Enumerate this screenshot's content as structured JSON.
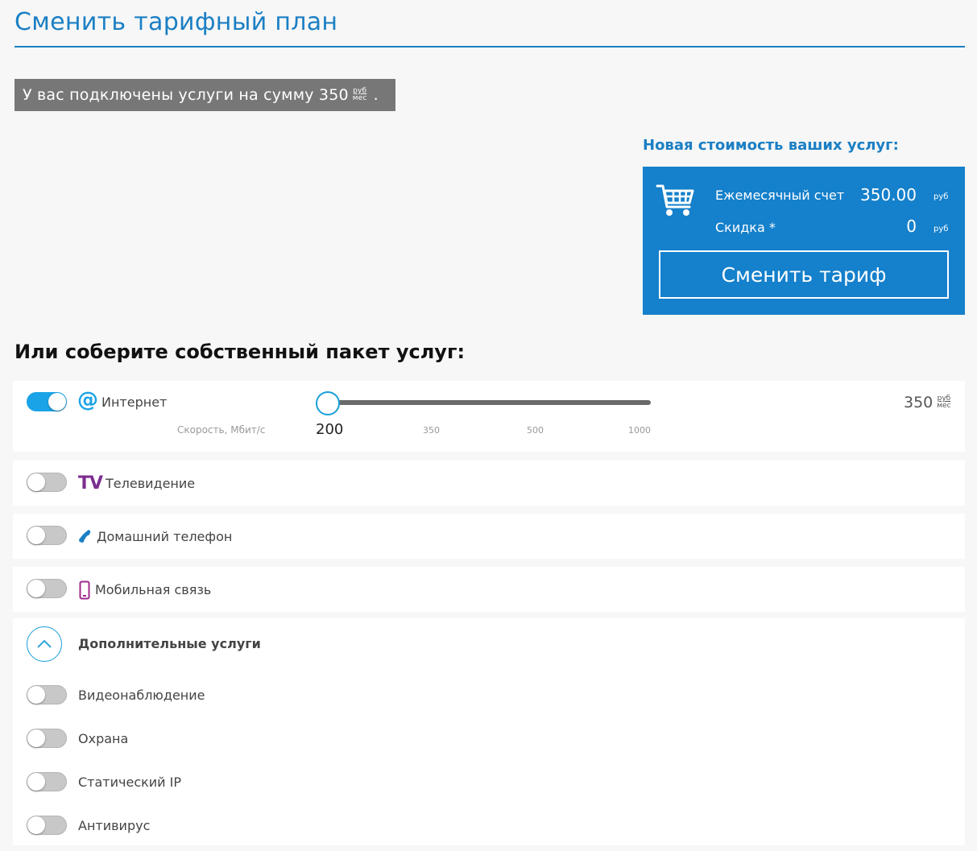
{
  "page": {
    "title": "Сменить тарифный план"
  },
  "current": {
    "text": "У вас подключены услуги на сумму 350",
    "unit_top": "руб",
    "unit_bottom": "мес",
    "suffix": "."
  },
  "new_cost": {
    "title": "Новая стоимость ваших услуг:",
    "monthly_label": "Ежемесячный счет",
    "monthly_value": "350.00",
    "discount_label": "Скидка *",
    "discount_value": "0",
    "currency": "руб",
    "change_button": "Сменить тариф",
    "cart_icon": "shopping-cart-icon",
    "panel_color": "#1580cb"
  },
  "custom": {
    "title": "Или соберите собственный пакет услуг:"
  },
  "internet": {
    "label": "Интернет",
    "icon": "at-sign-icon",
    "enabled": true,
    "speed_label": "Скорость, Мбит/с",
    "speed_options": [
      "200",
      "350",
      "500",
      "1000"
    ],
    "selected_speed": "200",
    "price": "350",
    "unit_top": "руб",
    "unit_bottom": "мес"
  },
  "services": [
    {
      "label": "Телевидение",
      "icon": "tv-logo-icon",
      "enabled": false,
      "tv_text": "TV"
    },
    {
      "label": "Домашний телефон",
      "icon": "phone-handset-icon",
      "enabled": false
    },
    {
      "label": "Мобильная связь",
      "icon": "mobile-phone-icon",
      "enabled": false
    }
  ],
  "additional": {
    "title": "Дополнительные услуги",
    "expanded": true,
    "items": [
      {
        "label": "Видеонаблюдение",
        "enabled": false
      },
      {
        "label": "Охрана",
        "enabled": false
      },
      {
        "label": "Статический IP",
        "enabled": false
      },
      {
        "label": "Антивирус",
        "enabled": false
      }
    ]
  },
  "colors": {
    "accent": "#1b7fc4",
    "toggle_on": "#1aa3e6",
    "tv_purple": "#7b2d8e",
    "mobile_magenta": "#a0288c"
  }
}
